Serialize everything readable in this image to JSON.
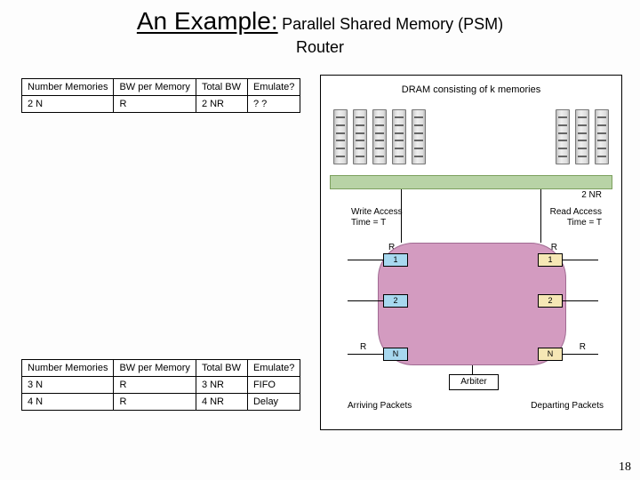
{
  "title": {
    "main": "An Example:",
    "sub_prefix": "Parallel Shared Memory (PSM)",
    "sub_suffix": "Router"
  },
  "table1": {
    "headers": [
      "Number Memories",
      "BW per Memory",
      "Total BW",
      "Emulate?"
    ],
    "rows": [
      [
        "2 N",
        "R",
        "2 NR",
        "? ?"
      ]
    ]
  },
  "table2": {
    "headers": [
      "Number Memories",
      "BW per Memory",
      "Total BW",
      "Emulate?"
    ],
    "rows": [
      [
        "3 N",
        "R",
        "3 NR",
        "FIFO"
      ],
      [
        "4 N",
        "R",
        "4 NR",
        "Delay"
      ]
    ]
  },
  "diagram": {
    "dram_label": "DRAM consisting of k memories",
    "bus_label": "2 NR",
    "write_access": "Write Access\nTime = T",
    "read_access": "Read Access\nTime = T",
    "rate": "R",
    "port1": "1",
    "port2": "2",
    "portN": "N",
    "arbiter": "Arbiter",
    "arriving": "Arriving Packets",
    "departing": "Departing Packets"
  },
  "page_number": "18"
}
